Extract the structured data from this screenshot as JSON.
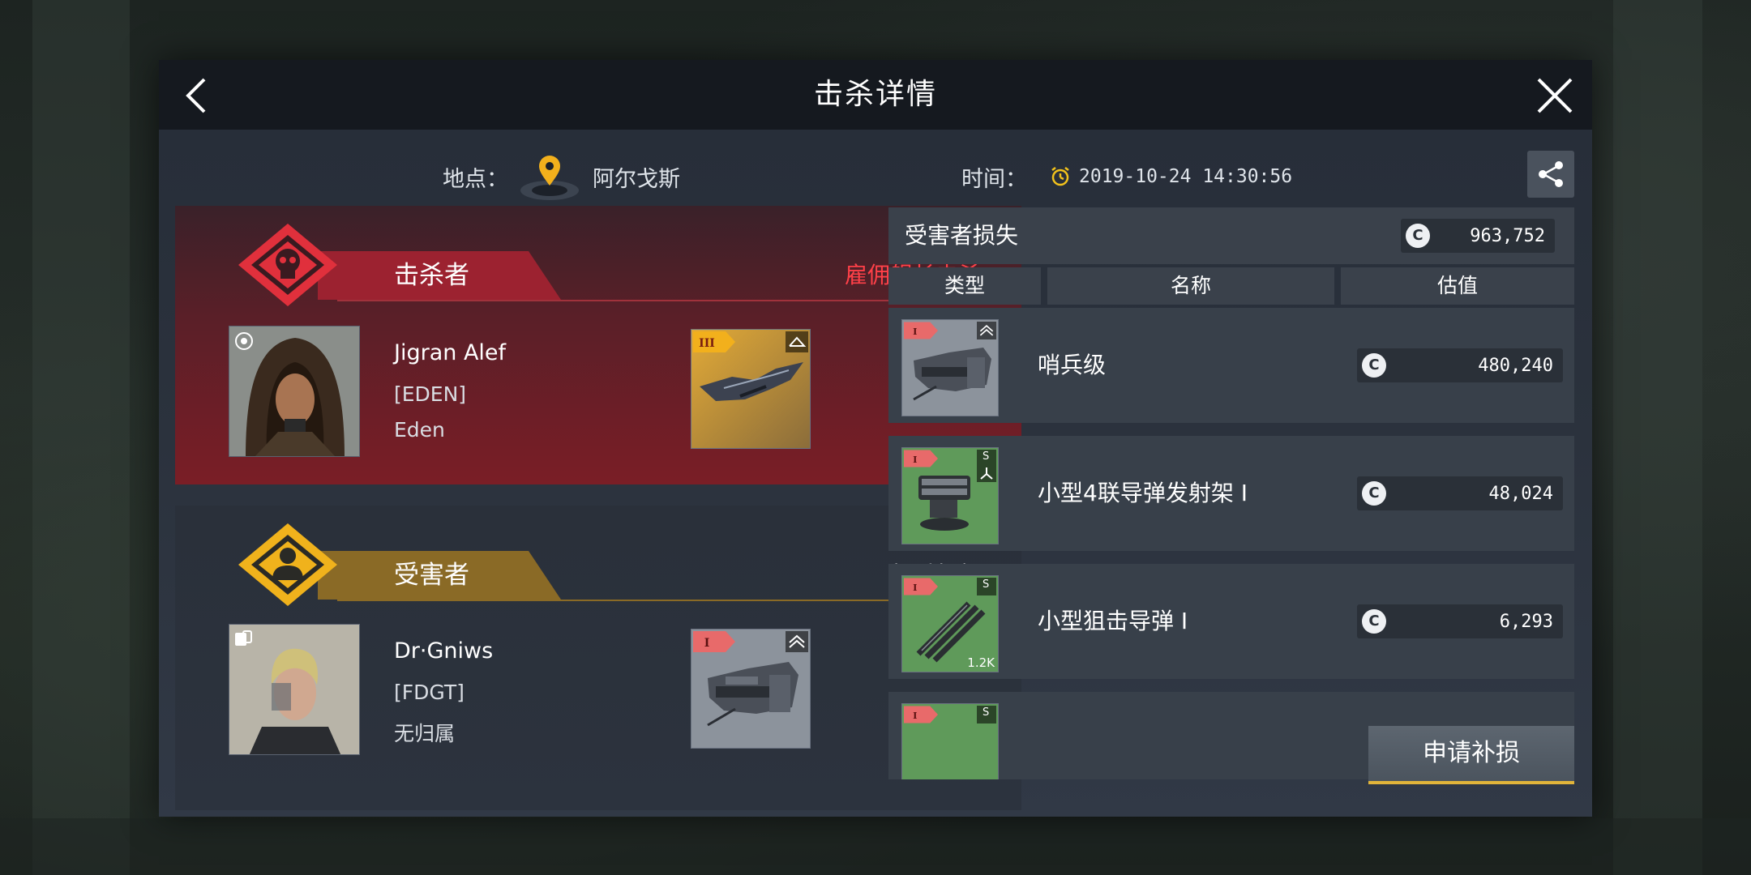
{
  "dialog": {
    "title": "击杀详情"
  },
  "location": {
    "label": "地点：",
    "value": "阿尔戈斯"
  },
  "time": {
    "label": "时间：",
    "value": "2019-10-24 14:30:56"
  },
  "killer": {
    "role_label": "击杀者",
    "kill_type": "雇佣舰长击杀",
    "name": "Jigran Alef",
    "corp": "[EDEN]",
    "alliance": "Eden",
    "ship_tier": "III"
  },
  "victim": {
    "role_label": "受害者",
    "status": "驾乘舰船",
    "name": "Dr·Gniws",
    "corp": "[FDGT]",
    "alliance": "无归属",
    "ship_tier": "I"
  },
  "loss": {
    "title": "受害者损失",
    "total": "963,752",
    "credit_symbol": "C",
    "columns": [
      "类型",
      "名称",
      "估值"
    ],
    "items": [
      {
        "name": "哨兵级",
        "value": "480,240",
        "tier": "I",
        "corner": "",
        "qty": "",
        "thumb": "ship"
      },
      {
        "name": "小型4联导弹发射架 I",
        "value": "48,024",
        "tier": "I",
        "corner": "S",
        "qty": "",
        "thumb": "launcher"
      },
      {
        "name": "小型狙击导弹 I",
        "value": "6,293",
        "tier": "I",
        "corner": "S",
        "qty": "1.2K",
        "thumb": "missile"
      },
      {
        "name": "",
        "value": "",
        "tier": "I",
        "corner": "S",
        "qty": "",
        "thumb": "green"
      }
    ]
  },
  "actions": {
    "claim_label": "申请补损"
  },
  "colors": {
    "killer_accent": "#e0303c",
    "victim_accent": "#f0b21c",
    "button_underline": "#e1b43a"
  }
}
